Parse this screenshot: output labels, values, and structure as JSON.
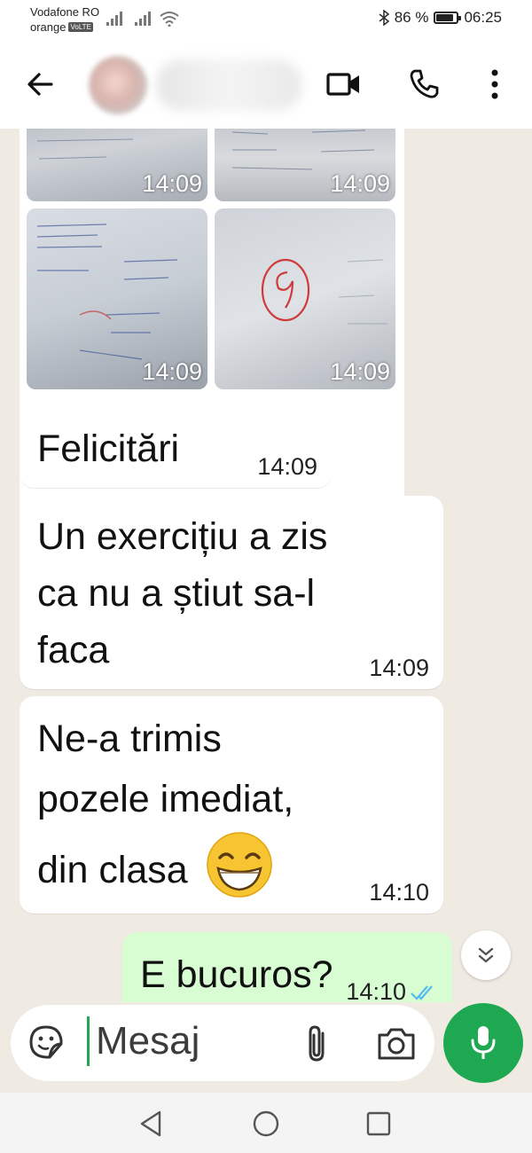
{
  "status_bar": {
    "carrier_1": "Vodafone RO",
    "carrier_2": "orange",
    "volte_badge": "VoLTE",
    "battery_text": "86 %",
    "battery_level": 0.86,
    "time": "06:25"
  },
  "header": {
    "contact_name_blurred": true,
    "icons": [
      "back-arrow-icon",
      "video-call-icon",
      "voice-call-icon",
      "more-options-icon"
    ]
  },
  "media_grid": {
    "items": [
      {
        "time": "14:09"
      },
      {
        "time": "14:09"
      },
      {
        "time": "14:09"
      },
      {
        "time": "14:09"
      }
    ]
  },
  "messages": [
    {
      "direction": "incoming",
      "lines": [
        "Felicitări"
      ],
      "time": "14:09"
    },
    {
      "direction": "incoming",
      "lines": [
        "Un exercițiu a zis",
        "ca nu a știut sa-l",
        "faca"
      ],
      "time": "14:09"
    },
    {
      "direction": "incoming",
      "lines": [
        "Ne-a trimis",
        "pozele imediat,",
        "din clasa"
      ],
      "emoji": "😁",
      "time": "14:10"
    },
    {
      "direction": "outgoing",
      "lines": [
        "E bucuros?"
      ],
      "time": "14:10",
      "status": "read"
    }
  ],
  "composer": {
    "placeholder": "Mesaj"
  },
  "colors": {
    "chat_background": "#efeae2",
    "incoming_bubble": "#ffffff",
    "outgoing_bubble": "#d9fdd3",
    "accent_green": "#1da851",
    "read_ticks": "#53bdeb"
  }
}
